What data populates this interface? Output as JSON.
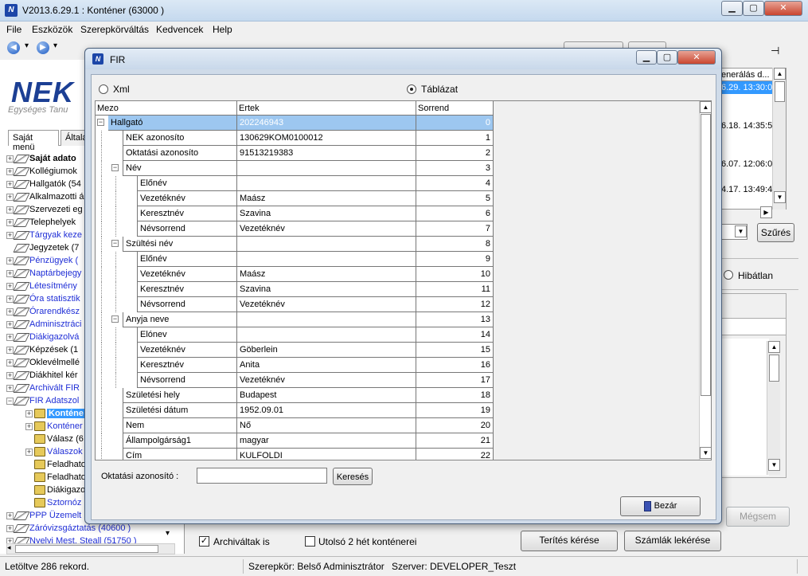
{
  "main": {
    "title": "V2013.6.29.1 : Konténer (63000 )",
    "controls": {
      "minimize": "▁",
      "maximize": "▢",
      "close": "✕"
    },
    "menu": [
      "File",
      "Eszközök",
      "Szerepkörváltás",
      "Kedvencek",
      "Help"
    ],
    "nav": {
      "back": "◀",
      "forward": "▶",
      "dropdown": "▾"
    },
    "logo": {
      "text": "NEK",
      "subtitle": "Egységes Tanu"
    },
    "left_tabs": [
      "Saját menü",
      "Általá"
    ],
    "tree": [
      {
        "label": "Saját adato",
        "bold": true,
        "blue": false,
        "exp": "+",
        "indent": 0,
        "icon": "tag"
      },
      {
        "label": "Kollégiumok",
        "bold": false,
        "blue": false,
        "exp": "+",
        "indent": 0,
        "icon": "tag"
      },
      {
        "label": "Hallgatók (54",
        "bold": false,
        "blue": false,
        "exp": "+",
        "indent": 0,
        "icon": "tag"
      },
      {
        "label": "Alkalmazotti á",
        "bold": false,
        "blue": false,
        "exp": "+",
        "indent": 0,
        "icon": "tag"
      },
      {
        "label": "Szervezeti eg",
        "bold": false,
        "blue": false,
        "exp": "+",
        "indent": 0,
        "icon": "tag"
      },
      {
        "label": "Telephelyek",
        "bold": false,
        "blue": false,
        "exp": "+",
        "indent": 0,
        "icon": "tag"
      },
      {
        "label": "Tárgyak keze",
        "bold": false,
        "blue": true,
        "exp": "+",
        "indent": 0,
        "icon": "tag"
      },
      {
        "label": "Jegyzetek (7",
        "bold": false,
        "blue": false,
        "exp": "",
        "indent": 0,
        "icon": "tag"
      },
      {
        "label": "Pénzügyek (",
        "bold": false,
        "blue": true,
        "exp": "+",
        "indent": 0,
        "icon": "tag"
      },
      {
        "label": "Naptárbejegy",
        "bold": false,
        "blue": true,
        "exp": "+",
        "indent": 0,
        "icon": "tag"
      },
      {
        "label": "Létesítmény",
        "bold": false,
        "blue": true,
        "exp": "+",
        "indent": 0,
        "icon": "tag"
      },
      {
        "label": "Óra statisztik",
        "bold": false,
        "blue": true,
        "exp": "+",
        "indent": 0,
        "icon": "tag"
      },
      {
        "label": "Órarendkész",
        "bold": false,
        "blue": true,
        "exp": "+",
        "indent": 0,
        "icon": "tag"
      },
      {
        "label": "Adminisztráci",
        "bold": false,
        "blue": true,
        "exp": "+",
        "indent": 0,
        "icon": "tag"
      },
      {
        "label": "Diákigazolvá",
        "bold": false,
        "blue": true,
        "exp": "+",
        "indent": 0,
        "icon": "tag"
      },
      {
        "label": "Képzések (1",
        "bold": false,
        "blue": false,
        "exp": "+",
        "indent": 0,
        "icon": "tag"
      },
      {
        "label": "Oklevélmellé",
        "bold": false,
        "blue": false,
        "exp": "+",
        "indent": 0,
        "icon": "tag"
      },
      {
        "label": "Diákhitel kér",
        "bold": false,
        "blue": false,
        "exp": "+",
        "indent": 0,
        "icon": "tag"
      },
      {
        "label": "Archivált FIR",
        "bold": false,
        "blue": true,
        "exp": "+",
        "indent": 0,
        "icon": "tag"
      },
      {
        "label": "FIR Adatszol",
        "bold": false,
        "blue": true,
        "exp": "−",
        "indent": 0,
        "icon": "tag"
      },
      {
        "label": "Konténe",
        "bold": true,
        "blue": false,
        "exp": "+",
        "indent": 1,
        "icon": "folder",
        "selected": true
      },
      {
        "label": "Konténer",
        "bold": false,
        "blue": true,
        "exp": "+",
        "indent": 1,
        "icon": "folder"
      },
      {
        "label": "Válasz (6",
        "bold": false,
        "blue": false,
        "exp": "",
        "indent": 1,
        "icon": "folder"
      },
      {
        "label": "Válaszok",
        "bold": false,
        "blue": true,
        "exp": "+",
        "indent": 1,
        "icon": "folder"
      },
      {
        "label": "Feladhato",
        "bold": false,
        "blue": false,
        "exp": "",
        "indent": 1,
        "icon": "folder"
      },
      {
        "label": "Feladhato",
        "bold": false,
        "blue": false,
        "exp": "",
        "indent": 1,
        "icon": "folder"
      },
      {
        "label": "Diákigazo",
        "bold": false,
        "blue": false,
        "exp": "",
        "indent": 1,
        "icon": "folder"
      },
      {
        "label": "Sztornóz",
        "bold": false,
        "blue": true,
        "exp": "",
        "indent": 1,
        "icon": "folder"
      },
      {
        "label": "PPP Üzemelt",
        "bold": false,
        "blue": true,
        "exp": "+",
        "indent": 0,
        "icon": "tag"
      },
      {
        "label": "Záróvizsgáztatás (40600 )",
        "bold": false,
        "blue": true,
        "exp": "+",
        "indent": 0,
        "icon": "tag"
      },
      {
        "label": "Nyelvi Mest. Steall (51750 )",
        "bold": false,
        "blue": true,
        "exp": "+",
        "indent": 0,
        "icon": "tag"
      }
    ],
    "right_dates": [
      "enerálás d...",
      "6.29. 13:30:0",
      "",
      "",
      "6.18. 14:35:5",
      "",
      "",
      "6.07. 12:06:0",
      "",
      "4.17. 13:49:4"
    ],
    "szures": "Szűrés",
    "hibatlan": "Hibátlan",
    "megsem": "Mégsem",
    "archivaltak": "Archiváltak is",
    "utolso": "Utolsó 2 hét konténerei",
    "terites": "Terítés kérése",
    "szamlak": "Számlák lekérése",
    "pin": "⊣"
  },
  "status": {
    "records": "Letöltve 286 rekord.",
    "role": "Szerepkör: Belső Adminisztrátor",
    "server": "Szerver: DEVELOPER_Teszt"
  },
  "fir": {
    "title": "FIR",
    "radio_xml": "Xml",
    "radio_table": "Táblázat",
    "headers": [
      "Mezo",
      "Ertek",
      "Sorrend"
    ],
    "rows": [
      {
        "label": "Hallgató",
        "value": "202246943",
        "order": "0",
        "level": 0,
        "exp": "−",
        "highlight": true
      },
      {
        "label": "NEK azonosíto",
        "value": "130629KOM0100012",
        "order": "1",
        "level": 1,
        "exp": ""
      },
      {
        "label": "Oktatási azonosíto",
        "value": "91513219383",
        "order": "2",
        "level": 1,
        "exp": ""
      },
      {
        "label": "Név",
        "value": "",
        "order": "3",
        "level": 1,
        "exp": "−"
      },
      {
        "label": "Előnév",
        "value": "",
        "order": "4",
        "level": 2,
        "exp": ""
      },
      {
        "label": "Vezetéknév",
        "value": "Maász",
        "order": "5",
        "level": 2,
        "exp": ""
      },
      {
        "label": "Keresztnév",
        "value": "Szavina",
        "order": "6",
        "level": 2,
        "exp": ""
      },
      {
        "label": "Névsorrend",
        "value": "Vezetéknév",
        "order": "7",
        "level": 2,
        "exp": ""
      },
      {
        "label": "Szültési név",
        "value": "",
        "order": "8",
        "level": 1,
        "exp": "−"
      },
      {
        "label": "Előnév",
        "value": "",
        "order": "9",
        "level": 2,
        "exp": ""
      },
      {
        "label": "Vezetéknév",
        "value": "Maász",
        "order": "10",
        "level": 2,
        "exp": ""
      },
      {
        "label": "Keresztnév",
        "value": "Szavina",
        "order": "11",
        "level": 2,
        "exp": ""
      },
      {
        "label": "Névsorrend",
        "value": "Vezetéknév",
        "order": "12",
        "level": 2,
        "exp": ""
      },
      {
        "label": "Anyja neve",
        "value": "",
        "order": "13",
        "level": 1,
        "exp": "−"
      },
      {
        "label": "Elónev",
        "value": "",
        "order": "14",
        "level": 2,
        "exp": ""
      },
      {
        "label": "Vezetéknév",
        "value": "Göberlein",
        "order": "15",
        "level": 2,
        "exp": ""
      },
      {
        "label": "Keresztnév",
        "value": "Anita",
        "order": "16",
        "level": 2,
        "exp": ""
      },
      {
        "label": "Névsorrend",
        "value": "Vezetéknév",
        "order": "17",
        "level": 2,
        "exp": ""
      },
      {
        "label": "Születési hely",
        "value": "Budapest",
        "order": "18",
        "level": 1,
        "exp": ""
      },
      {
        "label": "Születési dátum",
        "value": "1952.09.01",
        "order": "19",
        "level": 1,
        "exp": ""
      },
      {
        "label": "Nem",
        "value": "Nő",
        "order": "20",
        "level": 1,
        "exp": ""
      },
      {
        "label": "Állampolgárság1",
        "value": "magyar",
        "order": "21",
        "level": 1,
        "exp": ""
      },
      {
        "label": "Cím",
        "value": "KULFOLDI",
        "order": "22",
        "level": 1,
        "exp": ""
      }
    ],
    "search_label": "Oktatási azonosító :",
    "search_value": "",
    "search_button": "Keresés",
    "close_button": "Bezár"
  }
}
